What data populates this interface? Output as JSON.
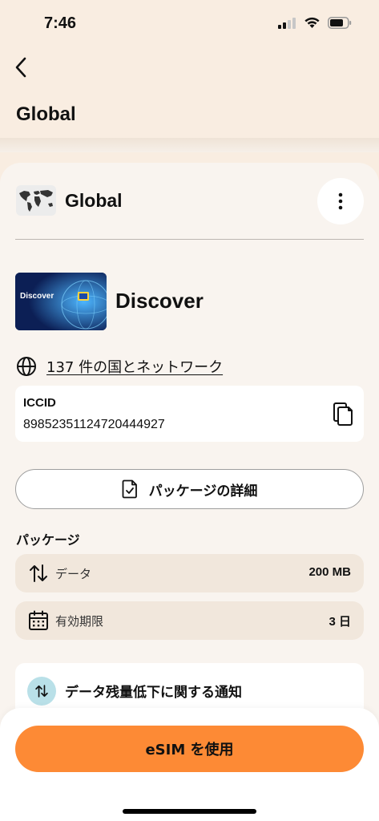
{
  "status_bar": {
    "time": "7:46",
    "signal_icon": "cellular-signal-icon",
    "wifi_icon": "wifi-icon",
    "battery_icon": "battery-icon"
  },
  "header": {
    "back_icon": "chevron-left-icon",
    "title": "Global"
  },
  "plan_card": {
    "region_name": "Global",
    "region_icon": "world-map-icon",
    "more_icon": "vertical-ellipsis-icon",
    "plan_image_label": "Discover",
    "plan_name": "Discover",
    "coverage_icon": "globe-icon",
    "coverage_link": "137 件の国とネットワーク",
    "iccid_label": "ICCID",
    "iccid_value": "89852351124720444927",
    "copy_icon": "copy-icon",
    "details_button": "パッケージの詳細",
    "details_icon": "document-check-icon"
  },
  "package": {
    "section_title": "パッケージ",
    "rows": [
      {
        "icon": "data-transfer-icon",
        "label": "データ",
        "value": "200 MB"
      },
      {
        "icon": "calendar-icon",
        "label": "有効期限",
        "value": "3 日"
      }
    ]
  },
  "notice": {
    "icon": "data-transfer-icon",
    "title": "データ残量低下に関する通知"
  },
  "footer": {
    "use_button": "eSIM を使用"
  },
  "colors": {
    "accent": "#fd8a35",
    "background": "#f9ede1",
    "card": "#f9f4ef",
    "row": "#f1e7dc",
    "notice_icon_bg": "#b9e0e8"
  }
}
